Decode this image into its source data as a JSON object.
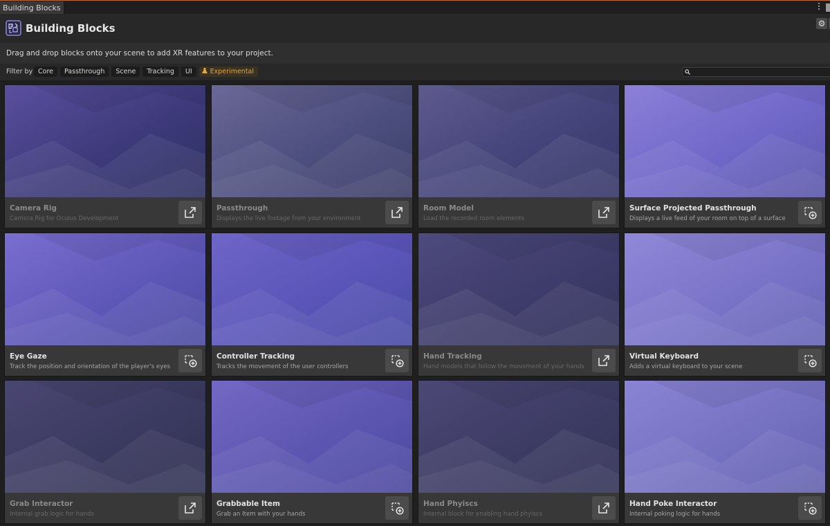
{
  "window": {
    "tab_label": "Building Blocks"
  },
  "header": {
    "title": "Building Blocks",
    "settings_icon": "gear-icon"
  },
  "description": "Drag and drop blocks onto your scene to add XR features to your project.",
  "filters": {
    "label": "Filter by",
    "chips": [
      "Core",
      "Passthrough",
      "Scene",
      "Tracking",
      "UI",
      "Experimental"
    ],
    "search_value": ""
  },
  "colors": {
    "accent_orange": "#e4a53a",
    "card_bg": "#3a3a3a",
    "panel_bg": "#282828"
  },
  "cards": [
    {
      "title": "Camera Rig",
      "subtitle": "Camera Rig for Oculus Development",
      "action": "open-external-icon",
      "dim": true
    },
    {
      "title": "Passthrough",
      "subtitle": "Displays the live footage from your environment",
      "action": "open-external-icon",
      "dim": true
    },
    {
      "title": "Room Model",
      "subtitle": "Load the recorded room elements",
      "action": "open-external-icon",
      "dim": true
    },
    {
      "title": "Surface Projected Passthrough",
      "subtitle": "Displays a live feed of your room on top of a surface",
      "action": "add-block-icon",
      "dim": false
    },
    {
      "title": "Eye Gaze",
      "subtitle": "Track the position and orientation of the player's eyes",
      "action": "add-block-icon",
      "dim": false
    },
    {
      "title": "Controller Tracking",
      "subtitle": "Tracks the movement of the user controllers",
      "action": "add-block-icon",
      "dim": false
    },
    {
      "title": "Hand Tracking",
      "subtitle": "Hand models that follow the movement of your hands",
      "action": "open-external-icon",
      "dim": true
    },
    {
      "title": "Virtual Keyboard",
      "subtitle": "Adds a virtual keyboard to your scene",
      "action": "add-block-icon",
      "dim": false
    },
    {
      "title": "Grab Interactor",
      "subtitle": "Internal grab logic for hands",
      "action": "open-external-icon",
      "dim": true
    },
    {
      "title": "Grabbable Item",
      "subtitle": "Grab an Item with your hands",
      "action": "add-block-icon",
      "dim": false
    },
    {
      "title": "Hand Phyiscs",
      "subtitle": "Internal block for enabling hand phyiscs",
      "action": "open-external-icon",
      "dim": true
    },
    {
      "title": "Hand Poke Interactor",
      "subtitle": "Internal poking logic for hands",
      "action": "add-block-icon",
      "dim": false
    }
  ]
}
